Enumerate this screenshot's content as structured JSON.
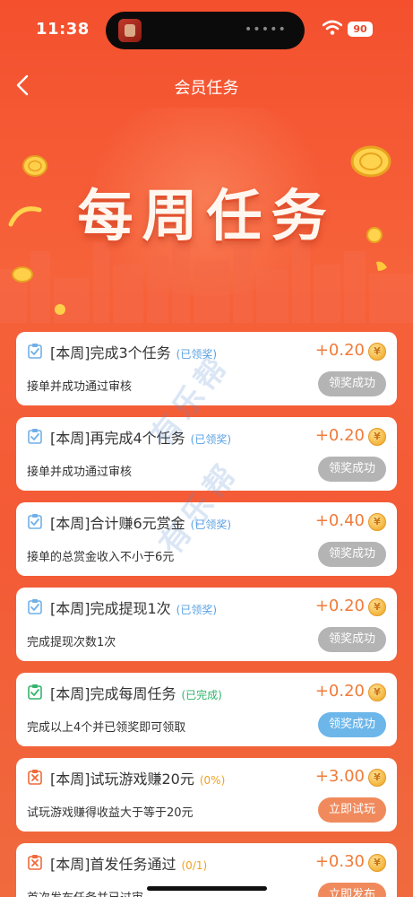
{
  "status": {
    "time": "11:38",
    "battery": "90",
    "island_dots": "•••••"
  },
  "nav": {
    "title": "会员任务"
  },
  "banner": {
    "title": "每周任务"
  },
  "watermark": "有乐帮",
  "tasks": [
    {
      "title": "[本周]完成3个任务",
      "tag": "(已领奖)",
      "reward": "+0.20",
      "desc": "接单并成功通过审核",
      "button": "领奖成功"
    },
    {
      "title": "[本周]再完成4个任务",
      "tag": "(已领奖)",
      "reward": "+0.20",
      "desc": "接单并成功通过审核",
      "button": "领奖成功"
    },
    {
      "title": "[本周]合计赚6元赏金",
      "tag": "(已领奖)",
      "reward": "+0.40",
      "desc": "接单的总赏金收入不小于6元",
      "button": "领奖成功"
    },
    {
      "title": "[本周]完成提现1次",
      "tag": "(已领奖)",
      "reward": "+0.20",
      "desc": "完成提现次数1次",
      "button": "领奖成功"
    },
    {
      "title": "[本周]完成每周任务",
      "tag": "(已完成)",
      "reward": "+0.20",
      "desc": "完成以上4个并已领奖即可领取",
      "button": "领奖成功"
    },
    {
      "title": "[本周]试玩游戏赚20元",
      "tag": "(0%)",
      "reward": "+3.00",
      "desc": "试玩游戏赚得收益大于等于20元",
      "button": "立即试玩"
    },
    {
      "title": "[本周]首发任务通过",
      "tag": "(0/1)",
      "reward": "+0.30",
      "desc": "首次发布任务并已过审",
      "button": "立即发布"
    }
  ],
  "coin_glyph": "¥",
  "colors": {
    "accent": "#f4502e",
    "reward": "#f07b3a",
    "btn_gray": "#b4b4b4",
    "btn_blue": "#6cb6ea",
    "btn_orange": "#f08a5c"
  }
}
